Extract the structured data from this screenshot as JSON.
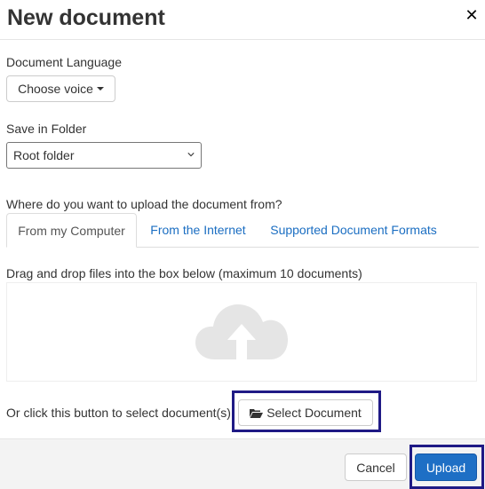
{
  "header": {
    "title": "New document",
    "close_icon": "close-icon"
  },
  "language": {
    "label": "Document Language",
    "button_label": "Choose voice"
  },
  "folder": {
    "label": "Save in Folder",
    "selected": "Root folder"
  },
  "upload_source": {
    "question": "Where do you want to upload the document from?",
    "tabs": [
      {
        "label": "From my Computer",
        "active": true
      },
      {
        "label": "From the Internet",
        "active": false
      },
      {
        "label": "Supported Document Formats",
        "active": false
      }
    ]
  },
  "dropzone": {
    "instruction": "Drag and drop files into the box below (maximum 10 documents)",
    "icon": "cloud-upload-icon"
  },
  "select_row": {
    "prompt": "Or click this button to select document(s)",
    "button_label": "Select Document",
    "icon": "folder-open-icon"
  },
  "footer": {
    "cancel_label": "Cancel",
    "upload_label": "Upload"
  },
  "colors": {
    "primary": "#1e6fc5",
    "link": "#1b6ec2",
    "highlight_border": "#1f1a85"
  }
}
